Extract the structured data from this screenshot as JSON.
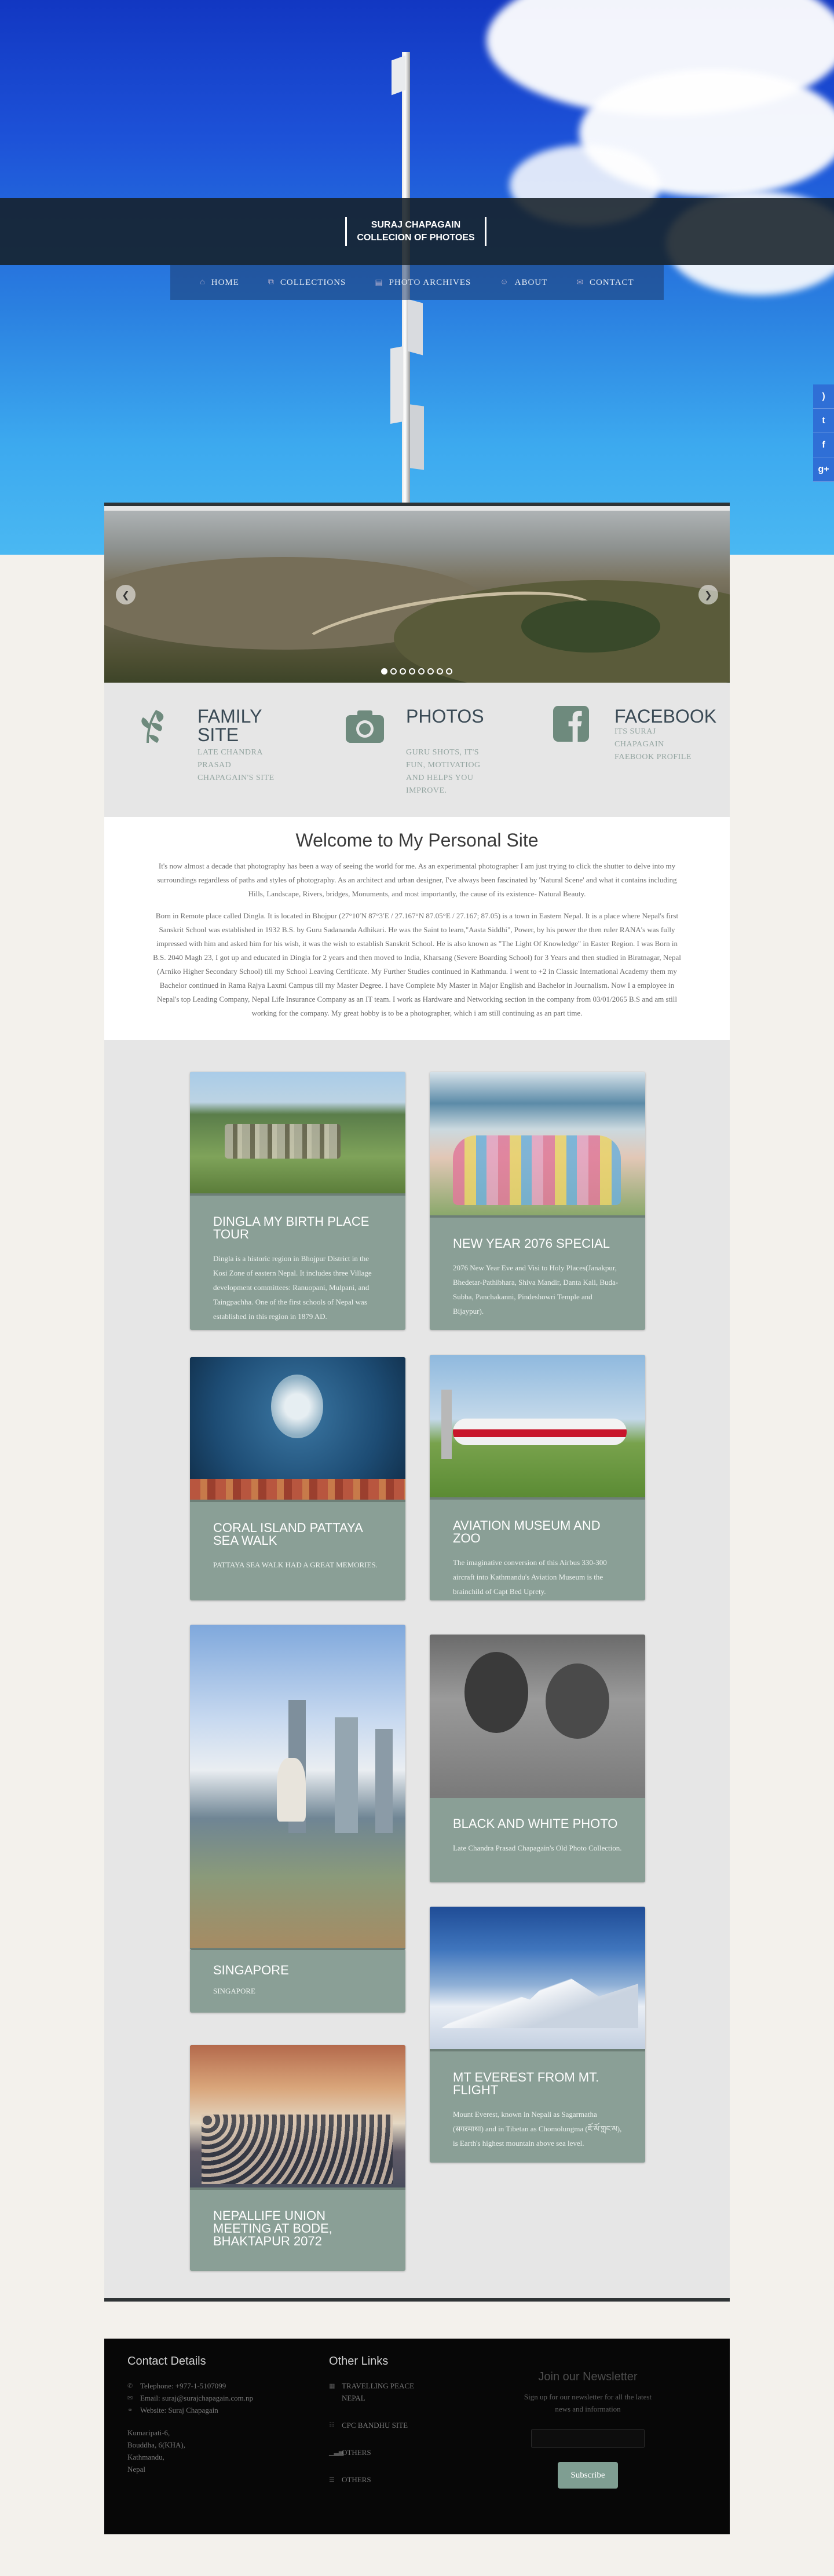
{
  "header": {
    "title_line1": "SURAJ CHAPAGAIN",
    "title_line2": "COLLECION OF PHOTOES"
  },
  "nav": [
    {
      "label": "HOME",
      "icon": "home-icon",
      "glyph": "⌂"
    },
    {
      "label": "COLLECTIONS",
      "icon": "tags-icon",
      "glyph": "⧉"
    },
    {
      "label": "PHOTO ARCHIVES",
      "icon": "archive-icon",
      "glyph": "▤"
    },
    {
      "label": "ABOUT",
      "icon": "about-icon",
      "glyph": "☺"
    },
    {
      "label": "CONTACT",
      "icon": "comment-icon",
      "glyph": "✉"
    }
  ],
  "social": [
    {
      "icon": "rss-icon",
      "glyph": ")"
    },
    {
      "icon": "twitter-icon",
      "glyph": "t"
    },
    {
      "icon": "facebook-icon",
      "glyph": "f"
    },
    {
      "icon": "google-plus-icon",
      "glyph": "g+"
    }
  ],
  "slider": {
    "prev": "❮",
    "next": "❯",
    "dot_count": 8,
    "active_dot": 1
  },
  "features": [
    {
      "icon": "leaf-icon",
      "title": "FAMILY SITE",
      "text": "LATE CHANDRA PRASAD CHAPAGAIN'S SITE"
    },
    {
      "icon": "camera-icon",
      "title": "PHOTOS",
      "text": "GURU SHOTS, IT'S FUN, MOTIVATIOG AND HELPS YOU IMPROVE."
    },
    {
      "icon": "facebook-icon",
      "title": "FACEBOOK",
      "text": "ITS SURAJ CHAPAGAIN FAEBOOK PROFILE"
    }
  ],
  "welcome": {
    "heading": "Welcome to My Personal Site",
    "para1": "It's now almost a decade that photography has been a way of seeing the world for me. As an experimental photographer I am just trying to click the shutter to delve into my surroundings regardless of paths and styles of photography. As an architect and urban designer, I've always been fascinated by 'Natural Scene' and what it contains including Hills, Landscape, Rivers, bridges, Monuments, and most importantly, the cause of its existence- Natural Beauty.",
    "para2": "Born in Remote place called Dingla. It is located in Bhojpur (27°10′N 87°3′E / 27.167°N 87.05°E / 27.167; 87.05) is a town in Eastern Nepal. It is a place where Nepal's first Sanskrit School was established in 1932 B.S. by Guru Sadananda Adhikari. He was the Saint to learn,\"Aasta Siddhi\", Power, by his power the then ruler RANA's was fully impressed with him and asked him for his wish, it was the wish to establish Sanskrit School. He is also known as \"The Light Of Knowledge\" in Easter Region. I was Born in B.S. 2040 Magh 23, I got up and educated in Dingla for 2 years and then moved to India, Kharsang (Severe Boarding School) for 3 Years and then studied in Biratnagar, Nepal (Arniko Higher Secondary School) till my School Leaving Certificate. My Further Studies continued in Kathmandu. I went to +2 in Classic International Academy them my Bachelor continued in Rama Rajya Laxmi Campus till my Master Degree. I have Complete My Master in Major English and Bachelor in Journalism. Now I a employee in Nepal's top Leading Company, Nepal Life Insurance Company as an IT team. I work as Hardware and Networking section in the company from 03/01/2065 B.S and am still working for the company. My great hobby is to be a photographer, which i am still continuing as an part time."
  },
  "cards": [
    {
      "title": "DINGLA MY BIRTH PLACE TOUR",
      "text": "Dingla is a historic region in Bhojpur District in the Kosi Zone of eastern Nepal. It includes three Village development committees: Ranuopani, Mulpani, and Taingpachha. One of the first schools of Nepal was established in this region in 1879 AD."
    },
    {
      "title": "NEW YEAR 2076 SPECIAL",
      "text": "2076 New Year Eve and Visi to Holy Places(Janakpur, Bhedetar-Pathibhara, Shiva Mandir, Danta Kali, Buda-Subba, Panchakanni, Pindeshowri Temple and Bijaypur)."
    },
    {
      "title": "CORAL ISLAND PATTAYA SEA WALK",
      "text": "PATTAYA SEA WALK HAD A GREAT MEMORIES."
    },
    {
      "title": "AVIATION MUSEUM AND ZOO",
      "text": "The imaginative conversion of this Airbus 330-300 aircraft into Kathmandu's Aviation Museum is the brainchild of Capt Bed Uprety."
    },
    {
      "title": "SINGAPORE",
      "text": "SINGAPORE"
    },
    {
      "title": "BLACK AND WHITE PHOTO",
      "text": "Late Chandra Prasad Chapagain's Old Photo Collection."
    },
    {
      "title": "NEPALLIFE UNION MEETING AT BODE, BHAKTAPUR 2072",
      "text": ""
    },
    {
      "title": "MT EVEREST FROM MT. FLIGHT",
      "text": "Mount Everest, known in Nepali as Sagarmatha (सगरमाथा) and in Tibetan as Chomolungma (ཇོ་མོ་གླང་མ), is Earth's highest mountain above sea level."
    }
  ],
  "footer": {
    "contact_title": "Contact Details",
    "telephone": "Telephone: +977-1-5107099",
    "email": "Email: suraj@surajchapagain.com.np",
    "website": "Website: Suraj Chapagain",
    "address": [
      "Kumaripati-6,",
      "Bouddha, 6(KHA),",
      "Kathmandu,",
      "Nepal"
    ],
    "links_title": "Other Links",
    "links": [
      {
        "label": "TRAVELLING PEACE NEPAL",
        "icon": "news-icon",
        "glyph": "▦"
      },
      {
        "label": "CPC BANDHU SITE",
        "icon": "group-icon",
        "glyph": "☷"
      },
      {
        "label": "OTHERS",
        "icon": "chart-icon",
        "glyph": "▁▃▅"
      },
      {
        "label": "OTHERS",
        "icon": "list-icon",
        "glyph": "☰"
      }
    ],
    "newsletter_title": "Join our Newsletter",
    "newsletter_text": "Sign up for our newsletter for all the latest news and information",
    "newsletter_placeholder": "",
    "subscribe_label": "Subscribe"
  }
}
